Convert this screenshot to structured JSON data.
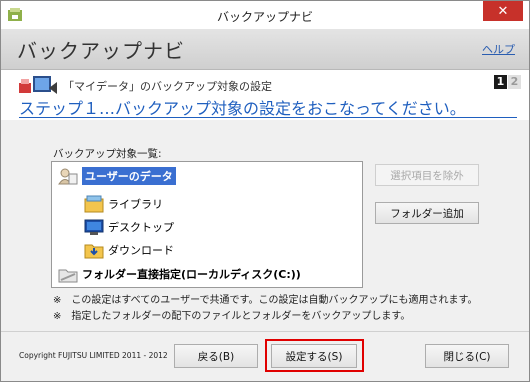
{
  "window": {
    "title": "バックアップナビ",
    "close_symbol": "✕"
  },
  "header": {
    "app_name": "バックアップナビ",
    "help_link": "ヘルプ"
  },
  "step": {
    "subtitle": "「マイデータ」のバックアップ対象の設定",
    "current": "1",
    "next": "2",
    "title": "ステップ１…バックアップ対象の設定をおこなってください。"
  },
  "backup_list": {
    "label": "バックアップ対象一覧:",
    "items": [
      {
        "label": "ユーザーのデータ",
        "icon": "user-data-icon",
        "selected": true
      },
      {
        "label": "ライブラリ",
        "icon": "library-icon"
      },
      {
        "label": "デスクトップ",
        "icon": "desktop-icon"
      },
      {
        "label": "ダウンロード",
        "icon": "download-folder-icon"
      },
      {
        "label": "フォルダー直接指定(ローカルディスク(C:))",
        "icon": "folder-direct-icon"
      }
    ]
  },
  "side_buttons": {
    "remove": "選択項目を除外",
    "add_folder": "フォルダー追加"
  },
  "notes": [
    "※　この設定はすべてのユーザーで共通です。この設定は自動バックアップにも適用されます。",
    "※　指定したフォルダーの配下のファイルとフォルダーをバックアップします。"
  ],
  "footer": {
    "copyright": "Copyright FUJITSU LIMITED 2011 - 2012",
    "back": "戻る(B)",
    "setup": "設定する(S)",
    "close": "閉じる(C)"
  },
  "colors": {
    "accent": "#1f5fbf",
    "selection": "#3a6fd1",
    "highlight_frame": "#e00000",
    "close_button": "#c7312a"
  }
}
